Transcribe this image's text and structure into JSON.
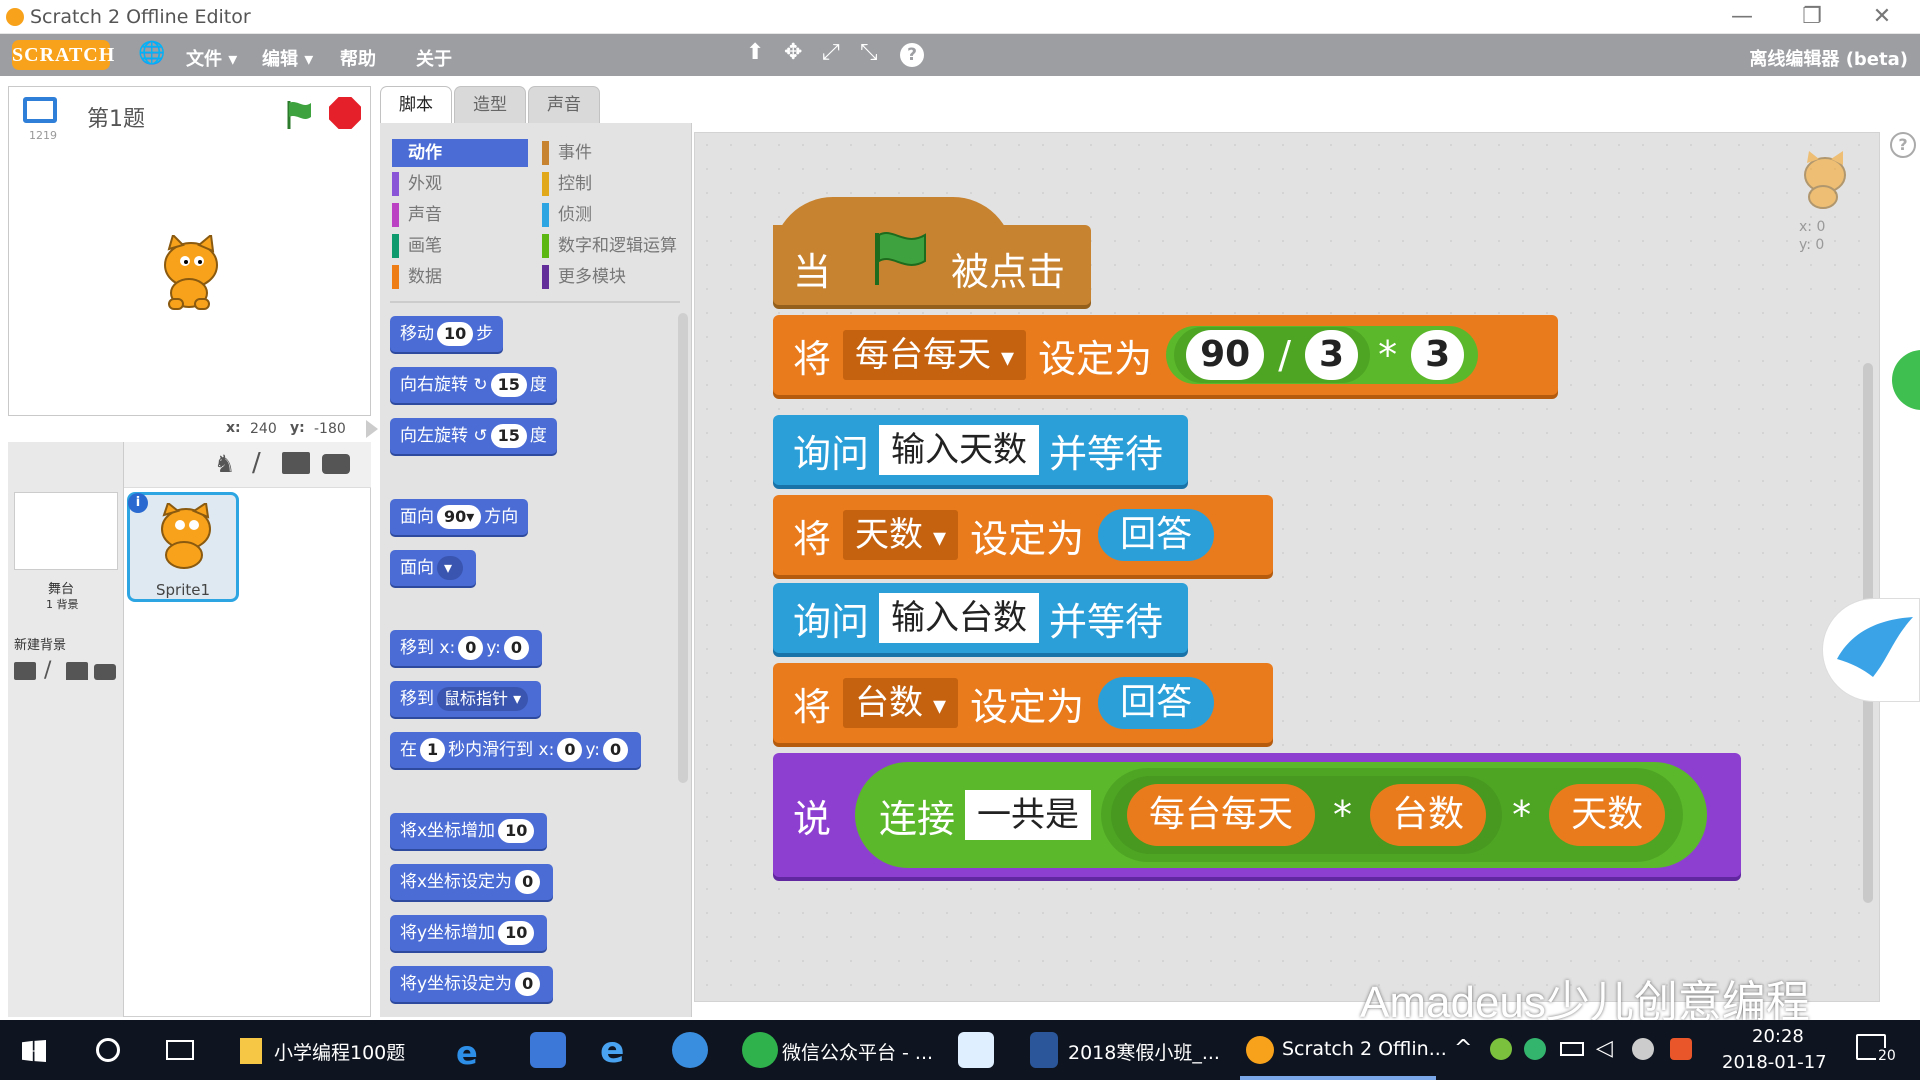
{
  "window": {
    "title": "Scratch 2 Offline Editor",
    "minimize": "—",
    "restore": "❐",
    "close": "✕"
  },
  "menubar": {
    "logo": "SCRATCH",
    "globe": "🌐",
    "items": [
      "文件 ▾",
      "编辑 ▾",
      "帮助",
      "关于"
    ],
    "right_label": "离线编辑器 (beta)",
    "tools": [
      "⬆",
      "✥",
      "⤢",
      "⤡",
      "?"
    ]
  },
  "stage": {
    "title": "第1题",
    "version": "1219",
    "x_label": "x:",
    "x_value": "240",
    "y_label": "y:",
    "y_value": "-180"
  },
  "sprites": {
    "stage_label": "舞台",
    "backdrops": "1 背景",
    "new_backdrop": "新建背景",
    "sprite_name": "Sprite1"
  },
  "tabs": [
    "脚本",
    "造型",
    "声音"
  ],
  "categories": {
    "left": [
      {
        "label": "动作",
        "color": "#4a6cd4"
      },
      {
        "label": "外观",
        "color": "#8a55d7"
      },
      {
        "label": "声音",
        "color": "#bb42c3"
      },
      {
        "label": "画笔",
        "color": "#0e9a6c"
      },
      {
        "label": "数据",
        "color": "#ee7d16"
      }
    ],
    "right": [
      {
        "label": "事件",
        "color": "#c88330"
      },
      {
        "label": "控制",
        "color": "#e1a91a"
      },
      {
        "label": "侦测",
        "color": "#2ca5e2"
      },
      {
        "label": "数字和逻辑运算",
        "color": "#5cb712"
      },
      {
        "label": "更多模块",
        "color": "#632d99"
      }
    ]
  },
  "palette": {
    "move": "移动",
    "move_val": "10",
    "steps": "步",
    "turn_right": "向右旋转",
    "turn_right_val": "15",
    "degrees": "度",
    "turn_left": "向左旋转",
    "turn_left_val": "15",
    "face_dir": "面向",
    "face_dir_val": "90▾",
    "direction": "方向",
    "face_toward": "面向",
    "goto_xy": "移到 x:",
    "goto_x": "0",
    "goto_y_label": "y:",
    "goto_y": "0",
    "goto": "移到",
    "goto_target": "鼠标指针 ▾",
    "glide_pre": "在",
    "glide_secs": "1",
    "glide_mid": "秒内滑行到 x:",
    "glide_x": "0",
    "glide_y_label": "y:",
    "glide_y": "0",
    "change_x": "将x坐标增加",
    "change_x_val": "10",
    "set_x": "将x坐标设定为",
    "set_x_val": "0",
    "change_y": "将y坐标增加",
    "change_y_val": "10",
    "set_y": "将y坐标设定为",
    "set_y_val": "0"
  },
  "script": {
    "hat_when": "当",
    "hat_clicked": "被点击",
    "set1_kw": "将",
    "set1_var": "每台每天",
    "set_to": "设定为",
    "n1": "90",
    "div": "/",
    "n2": "3",
    "mul": "*",
    "n3": "3",
    "ask1_kw": "询问",
    "ask1_text": "输入天数",
    "ask_wait": "并等待",
    "set2_kw": "将",
    "set2_var": "天数",
    "answer": "回答",
    "ask2_kw": "询问",
    "ask2_text": "输入台数",
    "set3_kw": "将",
    "set3_var": "台数",
    "say_kw": "说",
    "join": "连接",
    "join_text": "一共是",
    "r1": "每台每天",
    "r2": "台数",
    "r3": "天数"
  },
  "sprite_info": {
    "x": "x: 0",
    "y": "y: 0"
  },
  "watermark": "Amadeus少儿创意编程",
  "taskbar": {
    "folder_label": "小学编程100题",
    "wechat_label": "微信公众平台 - ...",
    "word_label": "2018寒假小班_...",
    "scratch_label": "Scratch 2 Offlin...",
    "time": "20:28",
    "date": "2018-01-17",
    "notif": "20"
  }
}
